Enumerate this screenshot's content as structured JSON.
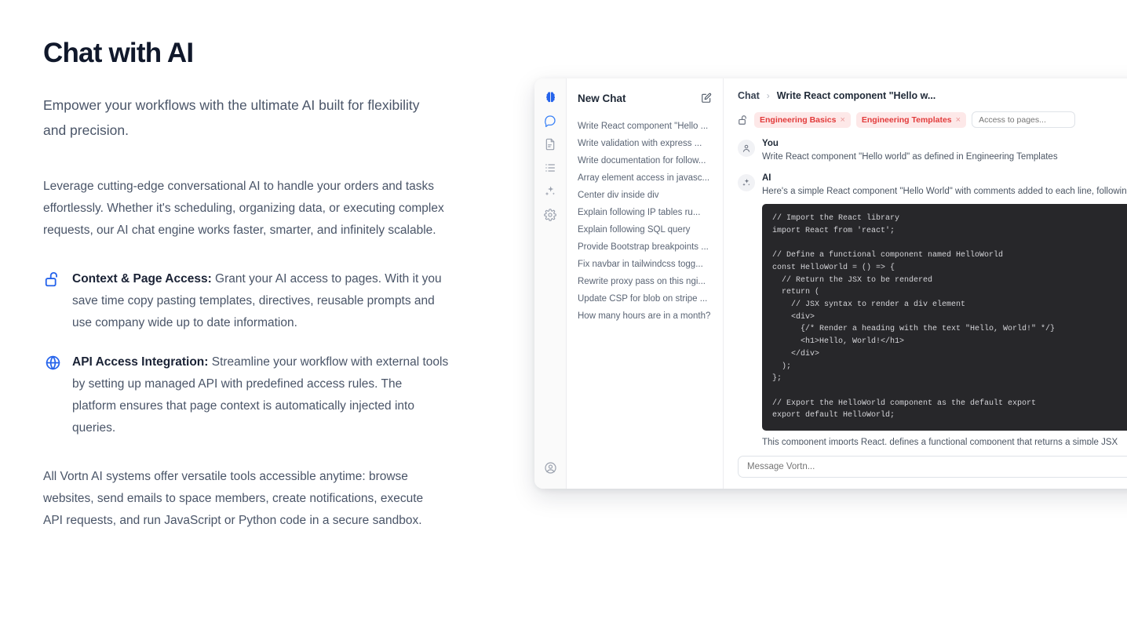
{
  "marketing": {
    "headline": "Chat with AI",
    "lead": "Empower your workflows with the ultimate AI built for flexibility and precision.",
    "body_paragraph": "Leverage cutting-edge conversational AI to handle your orders and tasks effortlessly. Whether it's scheduling, organizing data, or executing complex requests, our AI chat engine works faster, smarter, and infinitely scalable.",
    "features": [
      {
        "icon": "unlock-icon",
        "title": "Context & Page Access:",
        "description": " Grant your AI access to pages. With it you save time copy pasting templates, directives, reusable prompts and use company wide up to date information."
      },
      {
        "icon": "globe-icon",
        "title": "API Access Integration:",
        "description": " Streamline your workflow with external tools by setting up managed API with predefined access rules. The platform ensures that page context is automatically injected into queries."
      }
    ],
    "closing_paragraph": "All Vortn AI systems offer versatile tools accessible anytime: browse websites, send emails to space members, create notifications, execute API requests, and run JavaScript or Python code in a secure sandbox."
  },
  "app": {
    "rail": [
      {
        "name": "brain-icon",
        "label": "AI Brain",
        "state": "active"
      },
      {
        "name": "chat-icon",
        "label": "Chat",
        "state": "blue"
      },
      {
        "name": "document-icon",
        "label": "Documents",
        "state": "muted"
      },
      {
        "name": "list-icon",
        "label": "Lists",
        "state": "muted"
      },
      {
        "name": "sparkles-icon",
        "label": "Assistants",
        "state": "muted"
      },
      {
        "name": "gear-icon",
        "label": "Settings",
        "state": "muted"
      },
      {
        "name": "account-icon",
        "label": "Account",
        "state": "muted"
      }
    ],
    "sidebar": {
      "title": "New Chat",
      "compose_icon": "compose-edit-icon",
      "items": [
        "Write React component \"Hello ...",
        "Write validation with express ...",
        "Write documentation for follow...",
        "Array element access in javasc...",
        "Center div inside div",
        "Explain following IP tables ru...",
        "Explain following SQL query",
        "Provide Bootstrap breakpoints ...",
        "Fix navbar in tailwindcss togg...",
        "Rewrite proxy pass on this ngi...",
        "Update CSP for blob on stripe ...",
        "How many hours are in a month?"
      ]
    },
    "breadcrumb": {
      "root": "Chat",
      "separator": "›",
      "current": "Write React component \"Hello w..."
    },
    "tagbar": {
      "lock_icon": "unlock-icon",
      "tags": [
        {
          "label": "Engineering Basics",
          "remove": "×"
        },
        {
          "label": "Engineering Templates",
          "remove": "×"
        }
      ],
      "input_placeholder": "Access to pages..."
    },
    "messages": [
      {
        "avatar_icon": "user-avatar-icon",
        "author": "You",
        "text": "Write React component \"Hello world\" as defined in Engineering Templates"
      },
      {
        "avatar_icon": "sparkles-avatar-icon",
        "author": "AI",
        "text": "Here's a simple React component \"Hello World\" with comments added to each line, following the guidelines fr",
        "code": "// Import the React library\nimport React from 'react';\n\n// Define a functional component named HelloWorld\nconst HelloWorld = () => {\n  // Return the JSX to be rendered\n  return (\n    // JSX syntax to render a div element\n    <div>\n      {/* Render a heading with the text \"Hello, World!\" */}\n      <h1>Hello, World!</h1>\n    </div>\n  );\n};\n\n// Export the HelloWorld component as the default export\nexport default HelloWorld;",
        "summary": "This component imports React, defines a functional component that returns a simple JSX structure, and expor other parts of the application. Each line is commented to explain its purpose."
      }
    ],
    "composer": {
      "placeholder": "Message Vortn..."
    }
  },
  "colors": {
    "accent_blue": "#2563eb",
    "tag_bg": "#fde8e8",
    "tag_text": "#e23b3b",
    "heading": "#10182b",
    "body_text": "#4a5568",
    "code_bg": "#27272a"
  }
}
